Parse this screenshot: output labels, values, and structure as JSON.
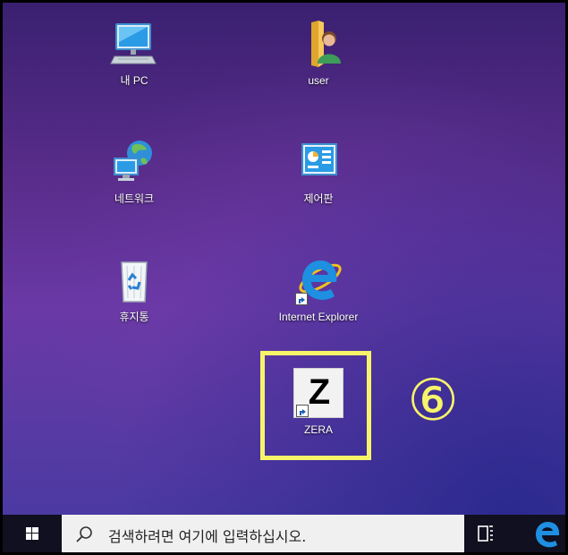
{
  "desktop": {
    "icons": [
      {
        "label": "내 PC",
        "icon": "computer-icon"
      },
      {
        "label": "user",
        "icon": "user-folder-icon"
      },
      {
        "label": "네트워크",
        "icon": "network-icon"
      },
      {
        "label": "제어판",
        "icon": "control-panel-icon"
      },
      {
        "label": "휴지통",
        "icon": "recycle-bin-icon"
      },
      {
        "label": "Internet Explorer",
        "icon": "internet-explorer-icon"
      },
      {
        "label": "ZERA",
        "icon": "zera-app-icon"
      }
    ],
    "zera_logo_letter": "Z"
  },
  "annotation": {
    "step_marker": "⑥",
    "color": "#f7f46a"
  },
  "taskbar": {
    "search_placeholder": "검색하려면 여기에 입력하십시오.",
    "start_icon": "windows-logo-icon",
    "task_view_icon": "task-view-icon",
    "browser_icon": "edge-browser-icon",
    "colors": {
      "bar": "#101020",
      "search_bg": "#f0f0f0",
      "edge": "#1e8fe1"
    }
  }
}
